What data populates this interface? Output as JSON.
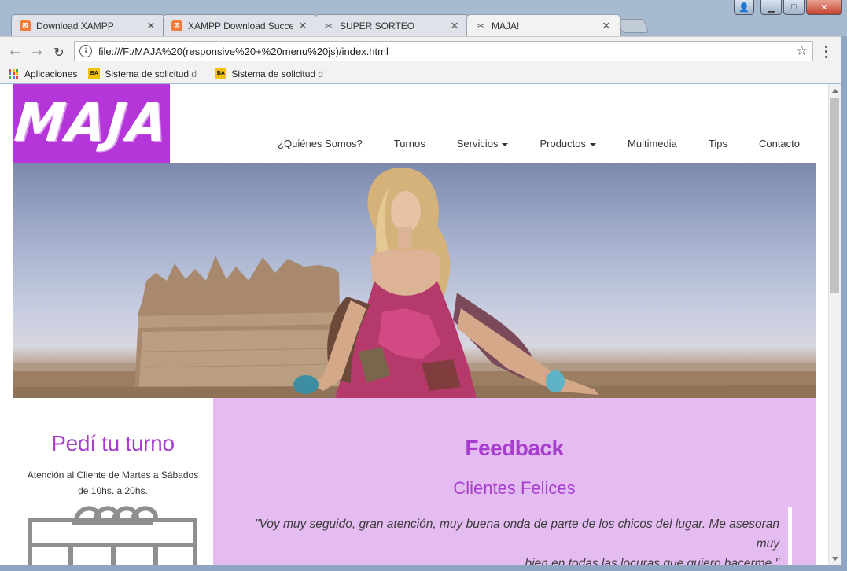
{
  "browser": {
    "tabs": [
      {
        "title": "Download XAMPP",
        "favicon": "xampp-icon"
      },
      {
        "title": "XAMPP Download Succe",
        "favicon": "xampp-icon"
      },
      {
        "title": "SUPER SORTEO",
        "favicon": "scissors-icon"
      },
      {
        "title": "MAJA!",
        "favicon": "scissors-icon"
      }
    ],
    "active_tab": 3,
    "url": "file:///F:/MAJA%20(responsive%20+%20menu%20js)/index.html",
    "bookmarks": {
      "apps_label": "Aplicaciones",
      "items": [
        {
          "label": "Sistema de solicitud d",
          "icon": "ba-icon",
          "icon_text": "BA"
        },
        {
          "label": "Sistema de solicitud d",
          "icon": "ba-icon",
          "icon_text": "BA"
        }
      ]
    }
  },
  "site": {
    "logo_text": "MAJA",
    "brand_color": "#b536d8",
    "nav": [
      {
        "label": "¿Quiénes Somos?",
        "dropdown": false
      },
      {
        "label": "Turnos",
        "dropdown": false
      },
      {
        "label": "Servicios",
        "dropdown": true
      },
      {
        "label": "Productos",
        "dropdown": true
      },
      {
        "label": "Multimedia",
        "dropdown": false
      },
      {
        "label": "Tips",
        "dropdown": false
      },
      {
        "label": "Contacto",
        "dropdown": false
      }
    ],
    "turno": {
      "title": "Pedí tu turno",
      "line1": "Atención al Cliente de Martes a Sábados",
      "line2": "de 10hs. a 20hs."
    },
    "feedback": {
      "title": "Feedback",
      "subtitle": "Clientes Felices",
      "quote_line1": "\"Voy muy seguido, gran atención, muy buena onda de parte de los chicos del lugar. Me asesoran muy",
      "quote_line2": "bien en todas las locuras que quiero hacerme.\""
    },
    "accent_color": "#a73dcc",
    "feedback_bg": "#e5bcf2"
  }
}
